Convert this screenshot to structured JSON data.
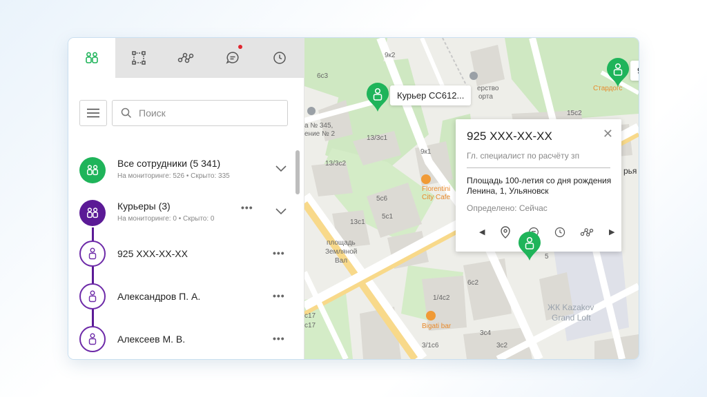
{
  "tabs": [
    {
      "name": "employees-icon"
    },
    {
      "name": "geofence-icon"
    },
    {
      "name": "route-icon"
    },
    {
      "name": "chat-icon",
      "has_notification": true
    },
    {
      "name": "history-icon"
    }
  ],
  "search": {
    "placeholder": "Поиск"
  },
  "groups": {
    "all": {
      "title": "Все сотрудники (5 341)",
      "sub": "На мониторинге: 526 • Скрыто: 335"
    },
    "couriers": {
      "title": "Курьеры (3)",
      "sub": "На мониторинге: 0 • Скрыто: 0"
    }
  },
  "employees": [
    {
      "name": "925 XXX-XX-XX"
    },
    {
      "name": "Александров П. А."
    },
    {
      "name": "Алексеев М. В."
    }
  ],
  "map": {
    "pin1_label": "Курьер СС612...",
    "pin2_label": "925 XXX-XX-XX",
    "labels": {
      "l1": "9к2",
      "l2": "6с3",
      "l3": "ерство",
      "l4": "орта",
      "l5": "15с2",
      "l6": "Стардогс",
      "l7": "а № 345,",
      "l8": "ение № 2",
      "l9": "13/3с1",
      "l10": "9к1",
      "l11": "13/3с2",
      "l12": "Florentini",
      "l13": "City Cafe",
      "l14": "5с6",
      "l15": "5с1",
      "l16": "13с1",
      "l17": "площадь",
      "l18": "Земляной",
      "l19": "Вал",
      "l20": "1/4с2",
      "l21": "6с2",
      "l22": "Bigati bar",
      "l23": "с17",
      "l24": "с17",
      "l25": "3/1с6",
      "l26": "3с4",
      "l27": "3с2",
      "l28": "ЖК Kazakov",
      "l29": "Grand Loft",
      "l30": "рья",
      "l31": "5"
    }
  },
  "card": {
    "title": "925 XXX-XX-XX",
    "role": "Гл. специалист по расчёту зп",
    "address": "Площадь 100-летия со дня рождения Ленина, 1, Ульяновск",
    "detected": "Определено: Сейчас",
    "close": "✕",
    "prev": "◀",
    "next": "▶"
  },
  "colors": {
    "accent_green": "#1fb45a",
    "accent_purple": "#5b1a96",
    "notification": "#e0262f"
  }
}
